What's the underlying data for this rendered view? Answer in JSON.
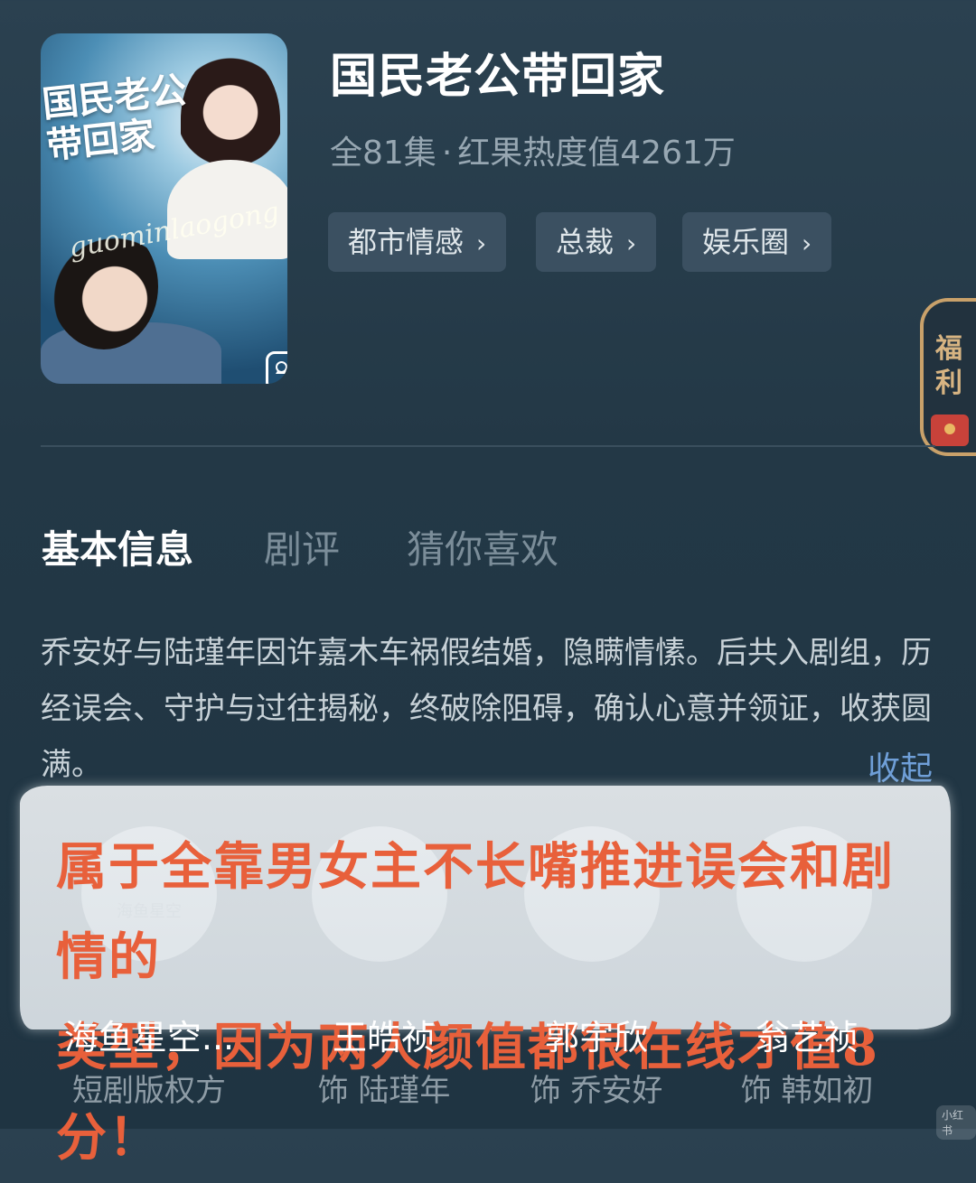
{
  "poster": {
    "title_art": "国民老公带回家",
    "script_text": "guominlaogong",
    "photo_icon": "image-gallery-icon"
  },
  "header": {
    "title": "国民老公带回家",
    "episodes": "全81集",
    "separator": "·",
    "heat": "红果热度值4261万"
  },
  "tags": [
    {
      "label": "都市情感"
    },
    {
      "label": "总裁"
    },
    {
      "label": "娱乐圈"
    }
  ],
  "welfare": {
    "label_1": "福",
    "label_2": "利"
  },
  "tabs": [
    {
      "label": "基本信息",
      "active": true
    },
    {
      "label": "剧评",
      "active": false
    },
    {
      "label": "猜你喜欢",
      "active": false
    }
  ],
  "synopsis": "乔安好与陆瑾年因许嘉木车祸假结婚，隐瞒情愫。后共入剧组，历经误会、守护与过往揭秘，终破除阻碍，确认心意并领证，收获圆满。",
  "collapse_label": "收起",
  "cast": [
    {
      "name": "海鱼星空...",
      "role": "短剧版权方"
    },
    {
      "name": "王皓祯",
      "role": "饰 陆瑾年"
    },
    {
      "name": "郭宇欣",
      "role": "饰 乔安好"
    },
    {
      "name": "翁艺祯",
      "role": "饰 韩如初"
    }
  ],
  "overlay_comment": {
    "line1": "属于全靠男女主不长嘴推进误会和剧情的",
    "line2": "类型，因为两人颜值都很在线才值8分！"
  },
  "watermark": "小红书",
  "colors": {
    "background": "#233846",
    "tag_bg": "#3b5061",
    "accent_link": "#6f9fd8",
    "overlay_text": "#e8603b",
    "welfare_gold": "#d7b482"
  }
}
